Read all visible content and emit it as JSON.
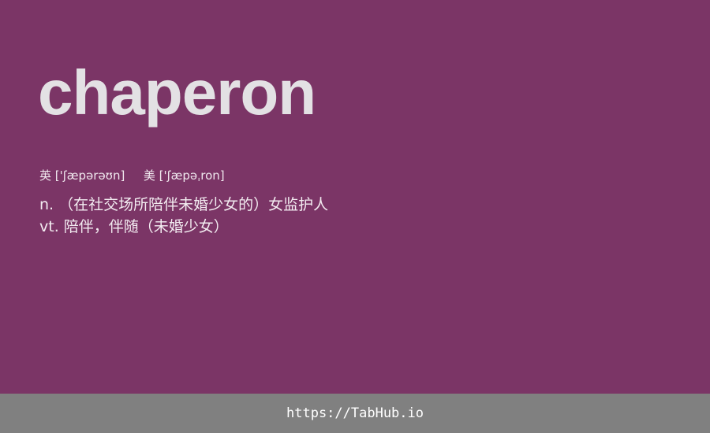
{
  "colors": {
    "background": "#7b3566",
    "word": "#e3e1e4",
    "text": "#f3ecf1",
    "footer_background": "#808080",
    "footer_text": "#ffffff"
  },
  "entry": {
    "word": "chaperon",
    "phonetics": {
      "uk_label": "英",
      "uk": "['ʃæpərəʊn]",
      "us_label": "美",
      "us": "['ʃæpəˌron]"
    },
    "definitions": [
      "n. （在社交场所陪伴未婚少女的）女监护人",
      "vt. 陪伴，伴随（未婚少女）"
    ]
  },
  "footer": {
    "link_text": "https://TabHub.io"
  }
}
